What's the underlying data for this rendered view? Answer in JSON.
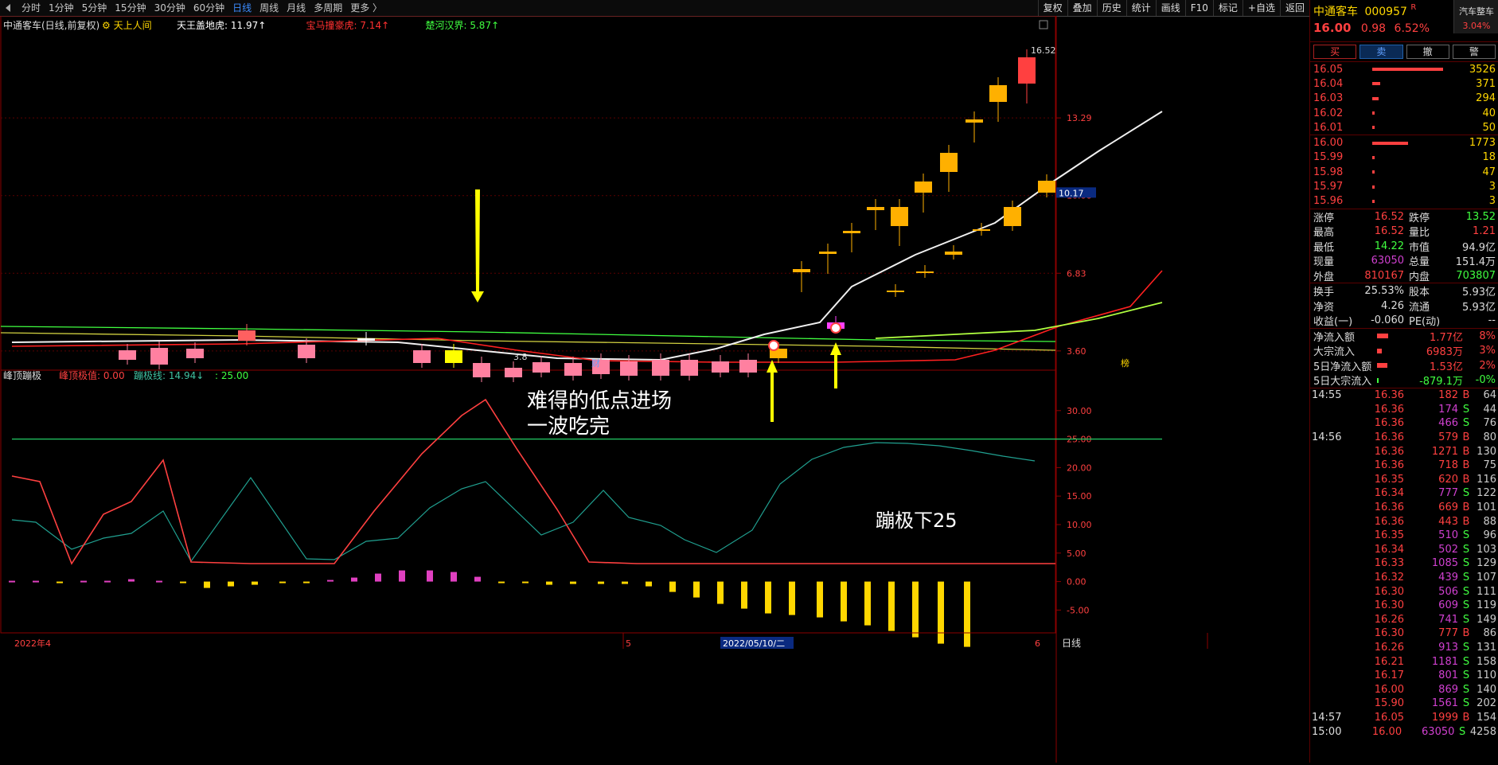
{
  "toolbar": {
    "periods": [
      "分时",
      "1分钟",
      "5分钟",
      "15分钟",
      "30分钟",
      "60分钟",
      "日线",
      "周线",
      "月线",
      "多周期",
      "更多 〉"
    ],
    "active_period": "日线",
    "tools": [
      "复权",
      "叠加",
      "历史",
      "统计",
      "画线",
      "F10",
      "标记",
      "+自选",
      "返回"
    ]
  },
  "main_chart": {
    "title": "中通客车(日线,前复权)",
    "indicator_name": "天上人间",
    "indicator_items": [
      {
        "label": "天王盖地虎: 11.97↑",
        "color": "#ffffff"
      },
      {
        "label": "宝马撞豪虎: 7.14↑",
        "color": "#ff3030"
      },
      {
        "label": "楚河汉界: 5.87↑",
        "color": "#40ff40"
      }
    ],
    "price_labels": [
      "13.29",
      "10.06",
      "6.83",
      "3.60"
    ],
    "current_price_tag": "10.17",
    "high_label": "16.52",
    "low_label": "3.8",
    "markers": [
      "财",
      "榜"
    ],
    "annotation_1": "难得的低点进场",
    "annotation_2": "一波吃完",
    "date_start": "2022年4",
    "date_mid": "5",
    "date_cursor": "2022/05/10/二",
    "date_end": "6",
    "period_label": "日线"
  },
  "chart_data": [
    {
      "type": "candlestick",
      "title": "中通客车(日线,前复权)",
      "ylim": [
        2.8,
        17.2
      ],
      "y_ticks": [
        13.29,
        10.06,
        6.83,
        3.6
      ],
      "series": [
        {
          "name": "天王盖地虎",
          "color": "#ffffff"
        },
        {
          "name": "宝马撞豪虎",
          "color": "#ff3030"
        },
        {
          "name": "楚河汉界",
          "color": "#40ff40"
        }
      ]
    },
    {
      "type": "line",
      "title": "峰顶蹦极",
      "ylim": [
        -9,
        35
      ],
      "y_ticks": [
        30,
        25,
        20,
        15,
        10,
        5,
        0,
        -5
      ],
      "series": [
        {
          "name": "峰顶极值",
          "color": "#ff4040",
          "latest": 0.0
        },
        {
          "name": "蹦极线",
          "color": "#20a090",
          "latest": 14.94
        },
        {
          "name": "25",
          "color": "#20c060",
          "values": [
            25
          ]
        }
      ]
    }
  ],
  "sub_chart": {
    "title": "峰顶蹦极",
    "items": [
      {
        "label": "峰顶极值: 0.00",
        "color": "#ff4040"
      },
      {
        "label": "蹦极线: 14.94↓",
        "color": "#40c0a0"
      },
      {
        "label": ": 25.00",
        "color": "#40ff40"
      }
    ],
    "y_labels": [
      "30.00",
      "25.00",
      "20.00",
      "15.00",
      "10.00",
      "5.00",
      "0.00",
      "-5.00"
    ],
    "annotation": "蹦极下25"
  },
  "quote": {
    "name": "中通客车",
    "code": "000957",
    "r_flag": "R",
    "sector": "汽车整车",
    "sector_change": "3.04%",
    "price": "16.00",
    "change": "0.98",
    "change_pct": "6.52%",
    "buttons": [
      "买",
      "卖",
      "撤",
      "警"
    ]
  },
  "order_book": {
    "asks": [
      {
        "price": "16.05",
        "vol": "3526",
        "bar": 0.9
      },
      {
        "price": "16.04",
        "vol": "371",
        "bar": 0.1
      },
      {
        "price": "16.03",
        "vol": "294",
        "bar": 0.08
      },
      {
        "price": "16.02",
        "vol": "40",
        "bar": 0.02
      },
      {
        "price": "16.01",
        "vol": "50",
        "bar": 0.02
      }
    ],
    "bids": [
      {
        "price": "16.00",
        "vol": "1773",
        "bar": 0.45
      },
      {
        "price": "15.99",
        "vol": "18",
        "bar": 0.01
      },
      {
        "price": "15.98",
        "vol": "47",
        "bar": 0.02
      },
      {
        "price": "15.97",
        "vol": "3",
        "bar": 0.01
      },
      {
        "price": "15.96",
        "vol": "3",
        "bar": 0.01
      }
    ]
  },
  "stats": [
    {
      "k": "涨停",
      "v": "16.52",
      "vc": "#ff4040",
      "k2": "跌停",
      "v2": "13.52",
      "v2c": "#40ff40"
    },
    {
      "k": "最高",
      "v": "16.52",
      "vc": "#ff4040",
      "k2": "量比",
      "v2": "1.21",
      "v2c": "#ff4040"
    },
    {
      "k": "最低",
      "v": "14.22",
      "vc": "#40ff40",
      "k2": "市值",
      "v2": "94.9亿",
      "v2c": "#dddddd"
    },
    {
      "k": "现量",
      "v": "63050",
      "vc": "#d040d0",
      "k2": "总量",
      "v2": "151.4万",
      "v2c": "#dddddd"
    },
    {
      "k": "外盘",
      "v": "810167",
      "vc": "#ff4040",
      "k2": "内盘",
      "v2": "703807",
      "v2c": "#40ff40"
    }
  ],
  "stats2": [
    {
      "k": "换手",
      "v": "25.53%",
      "vc": "#dddddd",
      "k2": "股本",
      "v2": "5.93亿",
      "v2c": "#dddddd"
    },
    {
      "k": "净资",
      "v": "4.26",
      "vc": "#dddddd",
      "k2": "流通",
      "v2": "5.93亿",
      "v2c": "#dddddd"
    },
    {
      "k": "收益(一)",
      "v": "-0.060",
      "vc": "#dddddd",
      "k2": "PE(动)",
      "v2": "--",
      "v2c": "#dddddd"
    }
  ],
  "flows": [
    {
      "k": "净流入额",
      "v": "1.77亿",
      "p": "8%",
      "c": "#ff4040",
      "bar": 0.5
    },
    {
      "k": "大宗流入",
      "v": "6983万",
      "p": "3%",
      "c": "#ff4040",
      "bar": 0.2
    },
    {
      "k": "5日净流入额",
      "v": "1.53亿",
      "p": "2%",
      "c": "#ff4040",
      "bar": 0.45
    },
    {
      "k": "5日大宗流入",
      "v": "-879.1万",
      "p": "-0%",
      "c": "#40ff40",
      "bar": 0.05
    }
  ],
  "ticks": [
    {
      "t": "14:55",
      "p": "16.36",
      "v": "182",
      "bs": "B",
      "n": "64"
    },
    {
      "t": "",
      "p": "16.36",
      "v": "174",
      "bs": "S",
      "n": "44"
    },
    {
      "t": "",
      "p": "16.36",
      "v": "466",
      "bs": "S",
      "n": "76"
    },
    {
      "t": "14:56",
      "p": "16.36",
      "v": "579",
      "bs": "B",
      "n": "80"
    },
    {
      "t": "",
      "p": "16.36",
      "v": "1271",
      "bs": "B",
      "n": "130"
    },
    {
      "t": "",
      "p": "16.36",
      "v": "718",
      "bs": "B",
      "n": "75"
    },
    {
      "t": "",
      "p": "16.35",
      "v": "620",
      "bs": "B",
      "n": "116"
    },
    {
      "t": "",
      "p": "16.34",
      "v": "777",
      "bs": "S",
      "n": "122"
    },
    {
      "t": "",
      "p": "16.36",
      "v": "669",
      "bs": "B",
      "n": "101"
    },
    {
      "t": "",
      "p": "16.36",
      "v": "443",
      "bs": "B",
      "n": "88"
    },
    {
      "t": "",
      "p": "16.35",
      "v": "510",
      "bs": "S",
      "n": "96"
    },
    {
      "t": "",
      "p": "16.34",
      "v": "502",
      "bs": "S",
      "n": "103"
    },
    {
      "t": "",
      "p": "16.33",
      "v": "1085",
      "bs": "S",
      "n": "129"
    },
    {
      "t": "",
      "p": "16.32",
      "v": "439",
      "bs": "S",
      "n": "107"
    },
    {
      "t": "",
      "p": "16.30",
      "v": "506",
      "bs": "S",
      "n": "111"
    },
    {
      "t": "",
      "p": "16.30",
      "v": "609",
      "bs": "S",
      "n": "119"
    },
    {
      "t": "",
      "p": "16.26",
      "v": "741",
      "bs": "S",
      "n": "149"
    },
    {
      "t": "",
      "p": "16.30",
      "v": "777",
      "bs": "B",
      "n": "86"
    },
    {
      "t": "",
      "p": "16.26",
      "v": "913",
      "bs": "S",
      "n": "131"
    },
    {
      "t": "",
      "p": "16.21",
      "v": "1181",
      "bs": "S",
      "n": "158"
    },
    {
      "t": "",
      "p": "16.17",
      "v": "801",
      "bs": "S",
      "n": "110"
    },
    {
      "t": "",
      "p": "16.00",
      "v": "869",
      "bs": "S",
      "n": "140"
    },
    {
      "t": "",
      "p": "15.90",
      "v": "1561",
      "bs": "S",
      "n": "202"
    },
    {
      "t": "14:57",
      "p": "16.05",
      "v": "1999",
      "bs": "B",
      "n": "154"
    },
    {
      "t": "15:00",
      "p": "16.00",
      "v": "63050",
      "bs": "S",
      "n": "4258"
    }
  ]
}
